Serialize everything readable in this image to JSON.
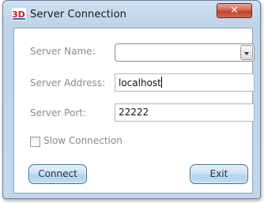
{
  "window": {
    "title": "Server Connection",
    "app_icon_text": "3D",
    "close_glyph": "✕"
  },
  "form": {
    "server_name_label": "Server Name:",
    "server_name_value": "",
    "server_address_label": "Server Address:",
    "server_address_value": "localhost",
    "server_port_label": "Server Port:",
    "server_port_value": "22222",
    "slow_connection_label": "Slow Connection",
    "slow_connection_checked": false
  },
  "buttons": {
    "connect_label": "Connect",
    "exit_label": "Exit"
  },
  "colors": {
    "title_bar": "#bfd4ea",
    "close_button": "#c2402a",
    "button_face": "#c9e3f5",
    "label_text": "#8a8a8a"
  },
  "icons": {
    "app": "3d-app-icon",
    "close": "close-icon",
    "dropdown": "chevron-down-icon"
  }
}
